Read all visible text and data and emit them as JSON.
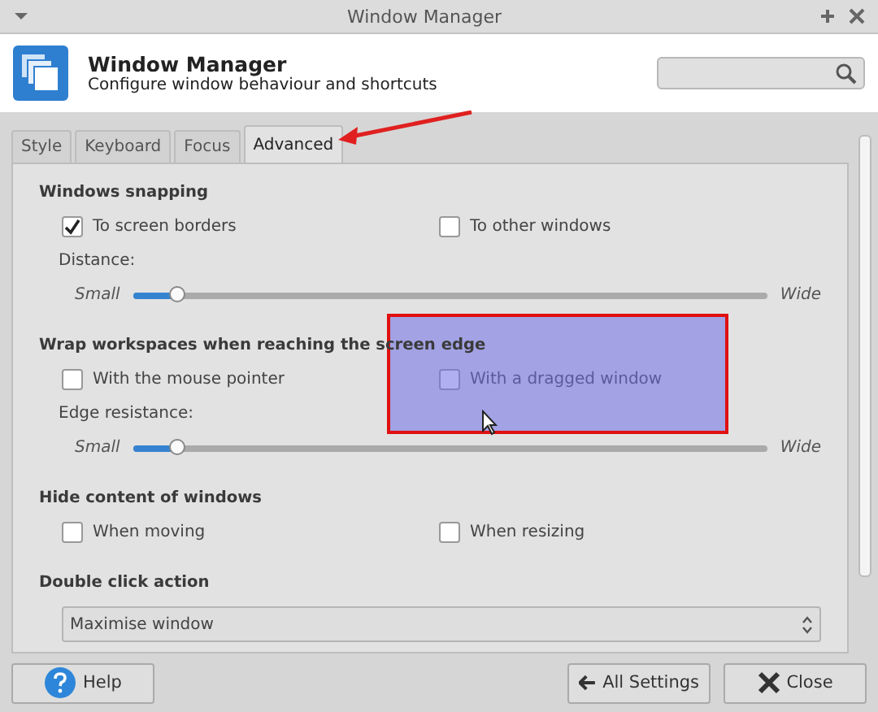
{
  "window": {
    "title": "Window Manager"
  },
  "header": {
    "title": "Window Manager",
    "subtitle": "Configure window behaviour and shortcuts"
  },
  "tabs": [
    {
      "label": "Style",
      "selected": false
    },
    {
      "label": "Keyboard",
      "selected": false
    },
    {
      "label": "Focus",
      "selected": false
    },
    {
      "label": "Advanced",
      "selected": true
    }
  ],
  "sections": [
    {
      "heading": "Windows snapping",
      "rows": [
        {
          "kind": "checks",
          "items": [
            {
              "label": "To screen borders",
              "checked": true
            },
            {
              "label": "To other windows",
              "checked": false
            }
          ]
        },
        {
          "kind": "label",
          "text": "Distance:"
        },
        {
          "kind": "slider",
          "min_label": "Small",
          "max_label": "Wide",
          "level": 0.07
        }
      ]
    },
    {
      "heading": "Wrap workspaces when reaching the screen edge",
      "rows": [
        {
          "kind": "checks",
          "items": [
            {
              "label": "With the mouse pointer",
              "checked": false
            },
            {
              "label": "With a dragged window",
              "checked": false
            }
          ]
        },
        {
          "kind": "label",
          "text": "Edge resistance:"
        },
        {
          "kind": "slider",
          "min_label": "Small",
          "max_label": "Wide",
          "level": 0.07
        }
      ]
    },
    {
      "heading": "Hide content of windows",
      "rows": [
        {
          "kind": "checks",
          "items": [
            {
              "label": "When moving",
              "checked": false
            },
            {
              "label": "When resizing",
              "checked": false
            }
          ]
        }
      ]
    },
    {
      "heading": "Double click action",
      "rows": [
        {
          "kind": "select",
          "value": "Maximise window"
        }
      ]
    }
  ],
  "buttons": [
    {
      "label": "Help",
      "kind": "help"
    },
    {
      "label": "All Settings",
      "kind": "back"
    },
    {
      "label": "Close",
      "kind": "close"
    }
  ]
}
